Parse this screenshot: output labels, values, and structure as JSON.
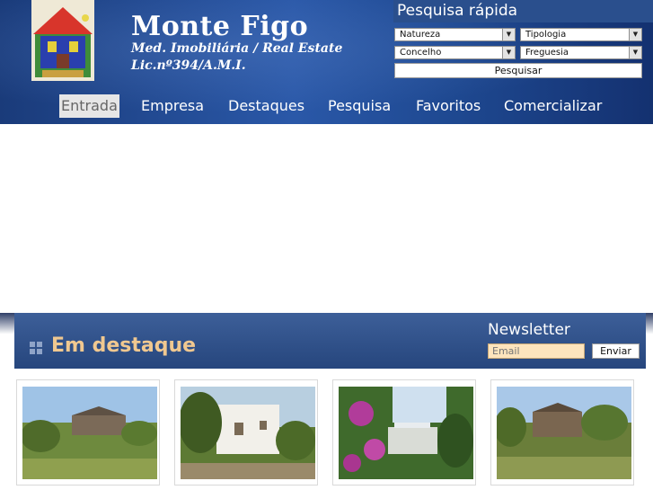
{
  "brand": {
    "name": "Monte Figo",
    "subtitle": "Med. Imobiliária / Real Estate",
    "license": "Lic.nº394/A.M.I."
  },
  "quick_search": {
    "title": "Pesquisa rápida",
    "nature": "Natureza",
    "typology": "Tipologia",
    "county": "Concelho",
    "parish": "Freguesia",
    "button": "Pesquisar"
  },
  "nav": {
    "items": [
      "Entrada",
      "Empresa",
      "Destaques",
      "Pesquisa",
      "Favoritos",
      "Comercializar"
    ],
    "active": "Entrada"
  },
  "featured": {
    "title": "Em destaque"
  },
  "newsletter": {
    "title": "Newsletter",
    "email_placeholder": "Email",
    "button": "Enviar"
  },
  "icons": {
    "dropdown": "chevron-down-icon",
    "featured": "grid-icon",
    "logo": "house-logo-icon"
  },
  "colors": {
    "header_blue": "#1e4890",
    "featured_title": "#f0c890",
    "email_field": "#fde4bd"
  }
}
